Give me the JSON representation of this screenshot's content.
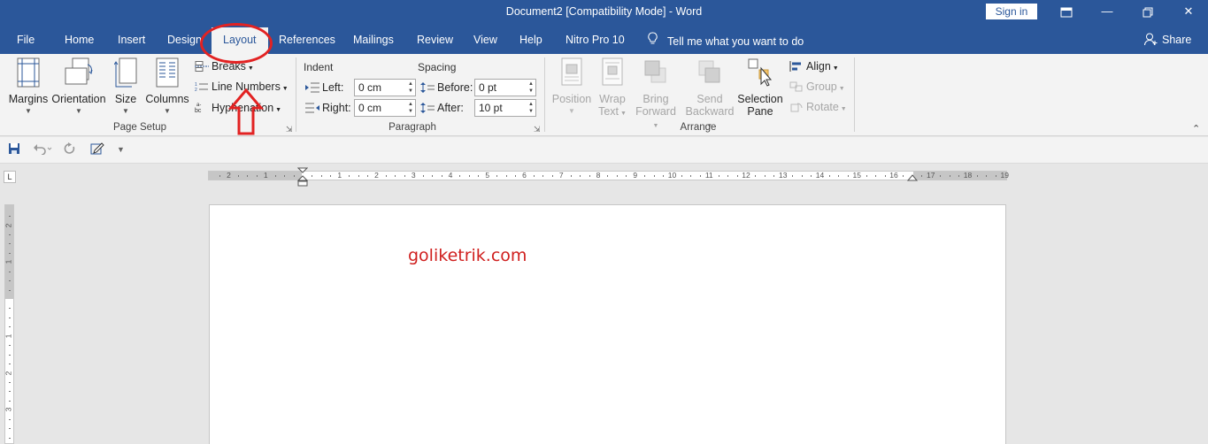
{
  "window": {
    "title": "Document2 [Compatibility Mode]  -  Word",
    "sign_in": "Sign in"
  },
  "tabs": [
    {
      "label": "File"
    },
    {
      "label": "Home"
    },
    {
      "label": "Insert"
    },
    {
      "label": "Design"
    },
    {
      "label": "Layout"
    },
    {
      "label": "References"
    },
    {
      "label": "Mailings"
    },
    {
      "label": "Review"
    },
    {
      "label": "View"
    },
    {
      "label": "Help"
    },
    {
      "label": "Nitro Pro 10"
    }
  ],
  "tell_me": "Tell me what you want to do",
  "share": "Share",
  "ribbon": {
    "page_setup": {
      "label": "Page Setup",
      "margins": "Margins",
      "orientation": "Orientation",
      "size": "Size",
      "columns": "Columns",
      "breaks": "Breaks",
      "line_numbers": "Line Numbers",
      "hyphenation": "Hyphenation"
    },
    "paragraph": {
      "label": "Paragraph",
      "indent": "Indent",
      "spacing": "Spacing",
      "left_label": "Left:",
      "left_value": "0 cm",
      "right_label": "Right:",
      "right_value": "0 cm",
      "before_label": "Before:",
      "before_value": "0 pt",
      "after_label": "After:",
      "after_value": "10 pt"
    },
    "arrange": {
      "label": "Arrange",
      "position": "Position",
      "wrap_text_1": "Wrap",
      "wrap_text_2": "Text",
      "bring_forward_1": "Bring",
      "bring_forward_2": "Forward",
      "send_backward_1": "Send",
      "send_backward_2": "Backward",
      "selection_pane_1": "Selection",
      "selection_pane_2": "Pane",
      "align": "Align",
      "group": "Group",
      "rotate": "Rotate"
    }
  },
  "ruler": {
    "horizontal_labels": [
      "2",
      "1",
      "1",
      "2",
      "3",
      "4",
      "5",
      "6",
      "7",
      "8",
      "9",
      "10",
      "11",
      "12",
      "13",
      "14",
      "15",
      "16",
      "17",
      "18",
      "19"
    ],
    "vertical_labels": [
      "2",
      "1",
      "1",
      "2",
      "3"
    ]
  },
  "document": {
    "text": "goliketrik.com"
  },
  "colors": {
    "brand": "#2b579a",
    "highlight": "#e22222",
    "doc_text": "#d0201f"
  }
}
